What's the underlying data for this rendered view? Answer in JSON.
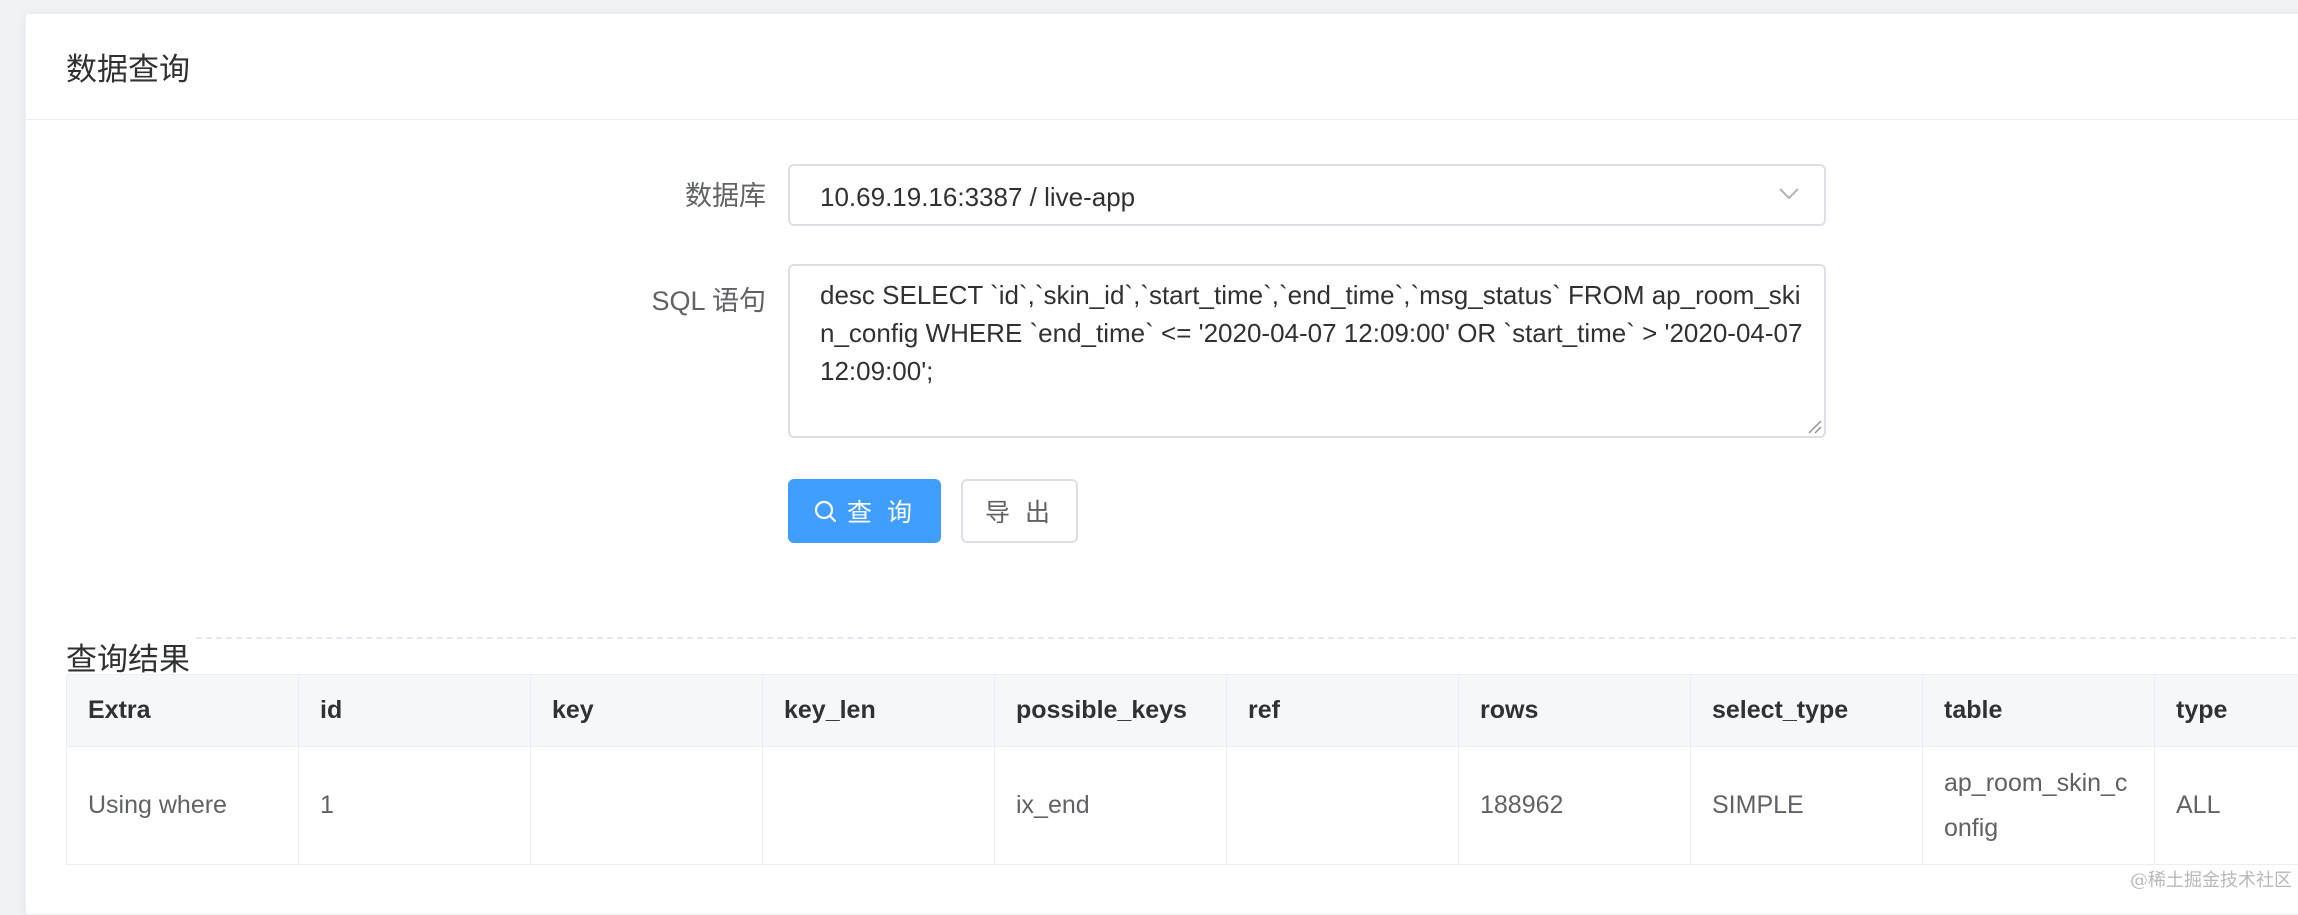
{
  "page": {
    "title": "数据查询"
  },
  "form": {
    "database_label": "数据库",
    "database_value": "10.69.19.16:3387 / live-app",
    "sql_label": "SQL 语句",
    "sql_value": "desc SELECT `id`,`skin_id`,`start_time`,`end_time`,`msg_status` FROM ap_room_skin_config WHERE `end_time` <= '2020-04-07 12:09:00' OR `start_time` > '2020-04-07 12:09:00';"
  },
  "buttons": {
    "query": "查 询",
    "export": "导 出"
  },
  "results": {
    "title": "查询结果",
    "columns": [
      "Extra",
      "id",
      "key",
      "key_len",
      "possible_keys",
      "ref",
      "rows",
      "select_type",
      "table",
      "type"
    ],
    "rows": [
      [
        "Using where",
        "1",
        "",
        "",
        "ix_end",
        "",
        "188962",
        "SIMPLE",
        "ap_room_skin_config",
        "ALL"
      ]
    ]
  },
  "watermark": "@稀土掘金技术社区",
  "icons": {
    "select_arrow": "chevron-down-icon",
    "query_button": "search-icon",
    "textarea_grip": "resize-grip-icon"
  },
  "colors": {
    "primary": "#409eff",
    "border": "#dcdfe6",
    "header_bg": "#f5f7fa",
    "text": "#303133",
    "secondary_text": "#606266"
  }
}
